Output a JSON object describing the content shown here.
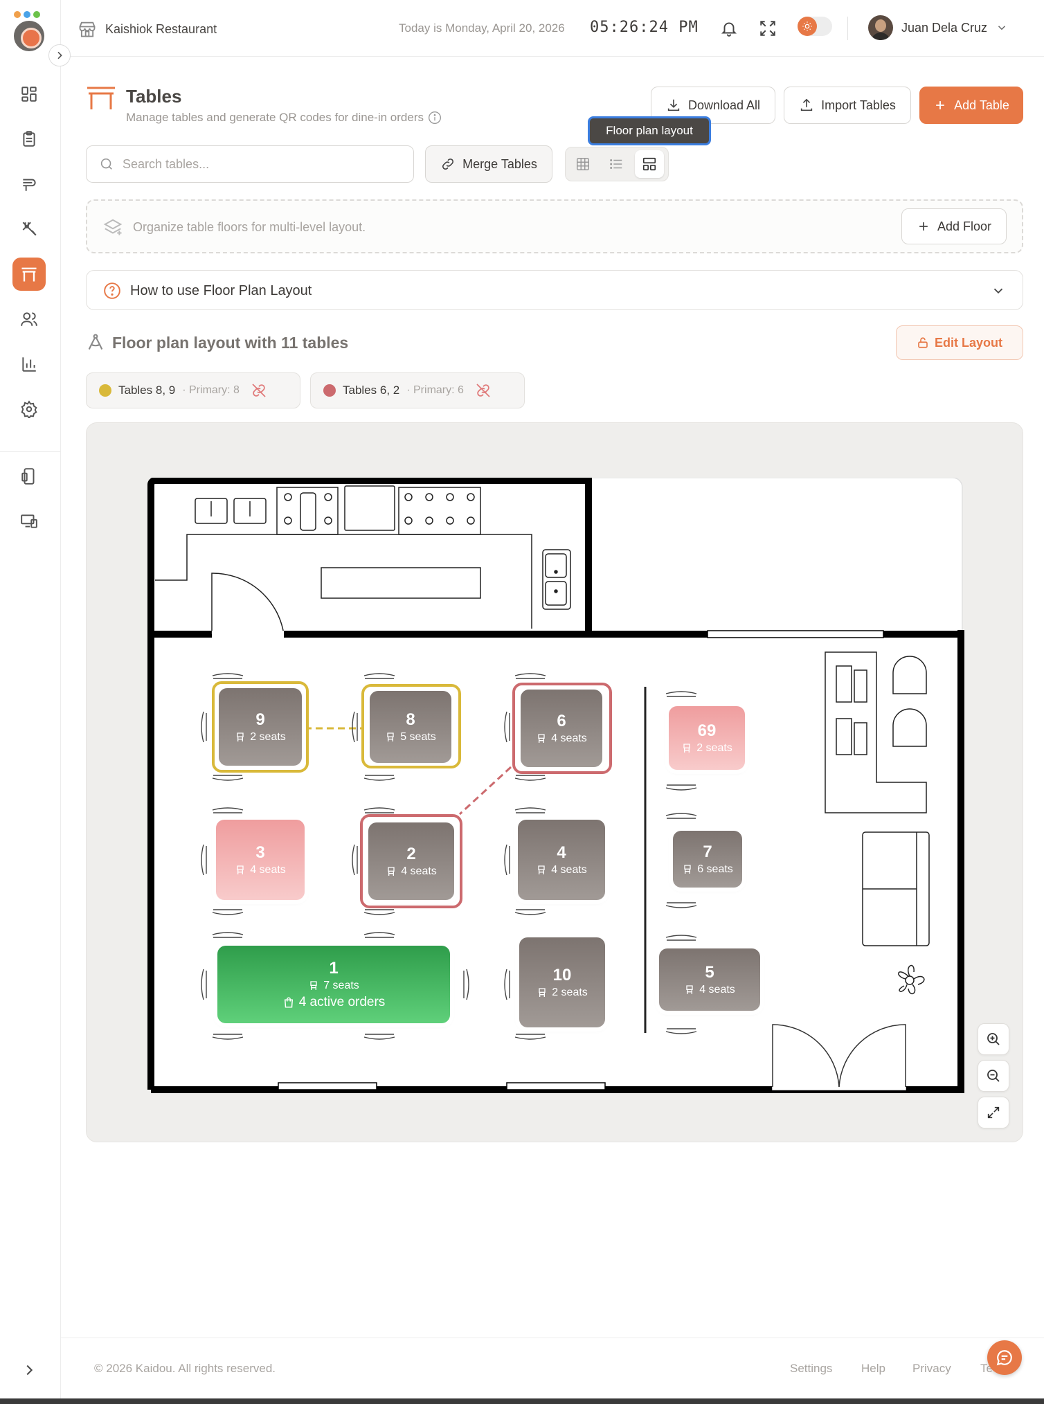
{
  "brand": {
    "colors": {
      "accent": "#e77846",
      "group_yellow": "#d9b93a",
      "group_red": "#cc6a6e",
      "active_green": "#3db35c"
    }
  },
  "topbar": {
    "restaurant_name": "Kaishiok Restaurant",
    "date_text": "Today is Monday, April 20, 2026",
    "clock": "05:26:24 PM",
    "user_name": "Juan Dela Cruz"
  },
  "sidebar": {
    "items": [
      {
        "icon": "dashboard-icon"
      },
      {
        "icon": "orders-icon"
      },
      {
        "icon": "menu-icon"
      },
      {
        "icon": "kitchen-icon"
      },
      {
        "icon": "tables-icon",
        "active": true
      },
      {
        "icon": "customers-icon"
      },
      {
        "icon": "reports-icon"
      },
      {
        "icon": "settings-icon"
      },
      {
        "icon": "mobile-icon"
      },
      {
        "icon": "devices-icon"
      }
    ]
  },
  "header": {
    "title": "Tables",
    "subtitle": "Manage tables and generate QR codes for dine-in orders",
    "download_label": "Download All",
    "import_label": "Import Tables",
    "add_label": "Add Table",
    "tooltip": "Floor plan layout"
  },
  "toolbar": {
    "search_placeholder": "Search tables...",
    "merge_label": "Merge Tables",
    "views": [
      "grid",
      "list",
      "floor-plan"
    ],
    "active_view": "floor-plan"
  },
  "floors": {
    "banner_text": "Organize table floors for multi-level layout.",
    "add_floor_label": "Add Floor"
  },
  "howto": {
    "label": "How to use Floor Plan Layout"
  },
  "layout": {
    "title": "Floor plan layout with 11 tables",
    "edit_label": "Edit Layout",
    "groups": [
      {
        "label": "Tables 8, 9",
        "primary": "· Primary: 8",
        "color": "#d9b93a"
      },
      {
        "label": "Tables 6, 2",
        "primary": "· Primary: 6",
        "color": "#cc6a6e"
      }
    ],
    "tables": [
      {
        "number": "9",
        "seats": "2 seats",
        "status": "occupied"
      },
      {
        "number": "8",
        "seats": "5 seats",
        "status": "occupied"
      },
      {
        "number": "6",
        "seats": "4 seats",
        "status": "occupied"
      },
      {
        "number": "69",
        "seats": "2 seats",
        "status": "reserved"
      },
      {
        "number": "3",
        "seats": "4 seats",
        "status": "reserved"
      },
      {
        "number": "2",
        "seats": "4 seats",
        "status": "occupied"
      },
      {
        "number": "4",
        "seats": "4 seats",
        "status": "occupied"
      },
      {
        "number": "7",
        "seats": "6 seats",
        "status": "occupied"
      },
      {
        "number": "1",
        "seats": "7 seats",
        "orders": "4 active orders",
        "status": "active"
      },
      {
        "number": "10",
        "seats": "2 seats",
        "status": "occupied"
      },
      {
        "number": "5",
        "seats": "4 seats",
        "status": "occupied"
      }
    ]
  },
  "footer": {
    "copyright": "© 2026 Kaidou. All rights reserved.",
    "links": [
      "Settings",
      "Help",
      "Privacy",
      "Te"
    ]
  }
}
